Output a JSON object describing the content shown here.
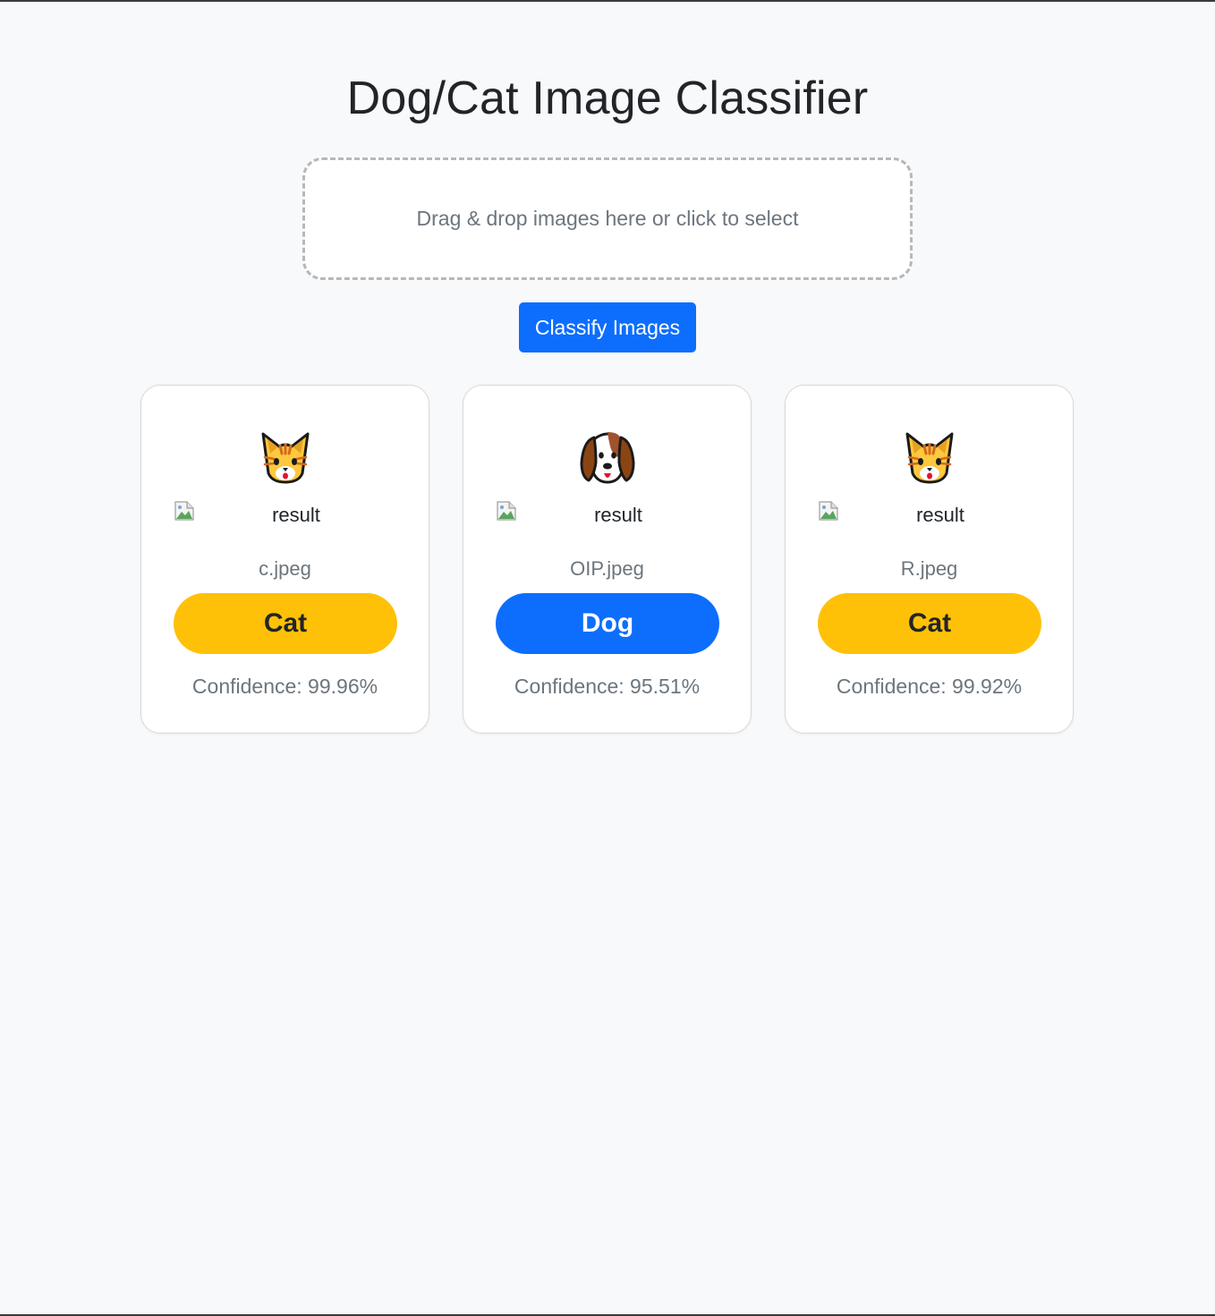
{
  "header": {
    "title": "Dog/Cat Image Classifier"
  },
  "dropzone": {
    "prompt": "Drag & drop images here or click to select"
  },
  "actions": {
    "classify_label": "Classify Images"
  },
  "results": [
    {
      "icon": "cat-face-icon",
      "image_alt": "result",
      "filename": "c.jpeg",
      "label": "Cat",
      "confidence": "Confidence: 99.96%"
    },
    {
      "icon": "dog-face-icon",
      "image_alt": "result",
      "filename": "OIP.jpeg",
      "label": "Dog",
      "confidence": "Confidence: 95.51%"
    },
    {
      "icon": "cat-face-icon",
      "image_alt": "result",
      "filename": "R.jpeg",
      "label": "Cat",
      "confidence": "Confidence: 99.92%"
    }
  ],
  "colors": {
    "page_background": "#f8f9fa",
    "primary": "#0d6efd",
    "cat_pill": "#ffc107",
    "dog_pill": "#0d6efd",
    "muted_text": "#6c757d"
  }
}
